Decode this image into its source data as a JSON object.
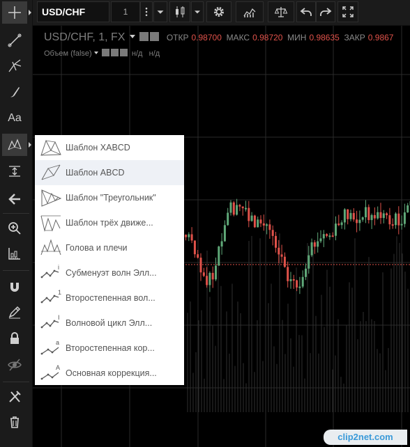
{
  "toolbar": {
    "symbol": "USD/CHF",
    "interval": "1"
  },
  "legend": {
    "title": "USD/CHF, 1, FX",
    "open_label": "ОТКР",
    "open_value": "0.98700",
    "high_label": "МАКС",
    "high_value": "0.98720",
    "low_label": "МИН",
    "low_value": "0.98635",
    "close_label": "ЗАКР",
    "close_value": "0.9867"
  },
  "volume": {
    "label": "Объем (false)",
    "value1": "н/д",
    "value2": "н/д"
  },
  "drawing_menu": {
    "items": [
      {
        "label": "Шаблон XABCD",
        "icon": "xabcd-pattern-icon"
      },
      {
        "label": "Шаблон ABCD",
        "icon": "abcd-pattern-icon"
      },
      {
        "label": "Шаблон \"Треугольник\"",
        "icon": "triangle-pattern-icon"
      },
      {
        "label": "Шаблон трёх движе...",
        "icon": "three-drives-pattern-icon"
      },
      {
        "label": "Голова и плечи",
        "icon": "head-shoulders-icon"
      },
      {
        "label": "Субменуэт волн Элл...",
        "icon": "elliott-subminuette-icon"
      },
      {
        "label": "Второстепенная вол...",
        "icon": "elliott-minor-wave-icon"
      },
      {
        "label": "Волновой цикл Элл...",
        "icon": "elliott-cycle-icon"
      },
      {
        "label": "Второстепенная кор...",
        "icon": "elliott-minor-correction-icon"
      },
      {
        "label": "Основная коррекция...",
        "icon": "elliott-major-correction-icon"
      }
    ],
    "wave_marks": [
      "i",
      "1",
      "I",
      "a",
      "A"
    ]
  },
  "left_toolbar": {
    "text_tool_label": "Aa"
  },
  "watermark": "clip2net.com",
  "colors": {
    "up": "#5fa878",
    "down": "#e0524a",
    "background": "#000000",
    "grid": "#2a2a2a"
  }
}
